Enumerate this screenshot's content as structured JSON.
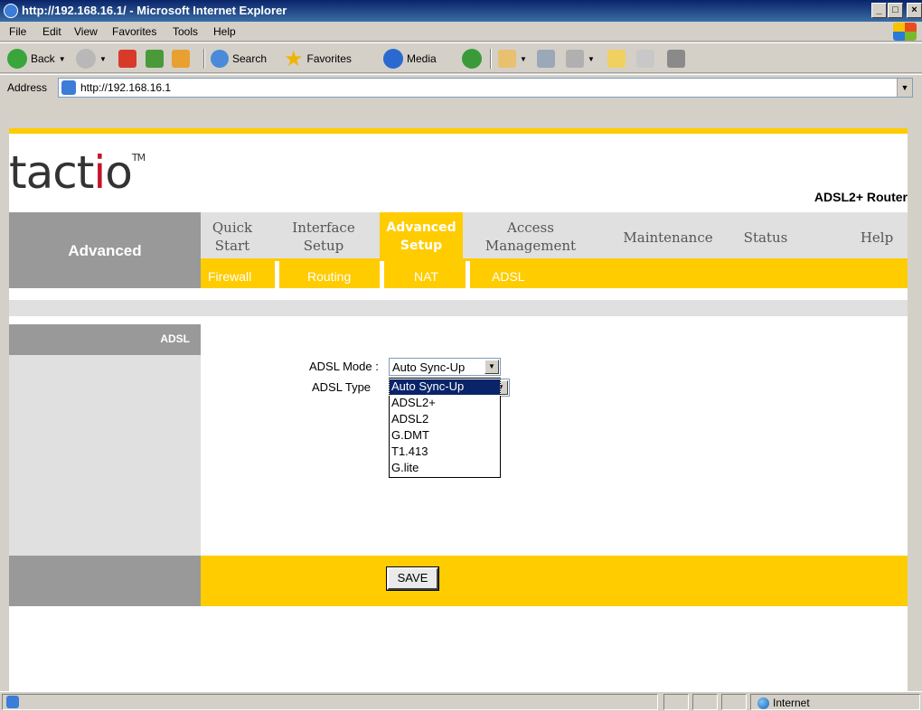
{
  "window": {
    "title": "http://192.168.16.1/ - Microsoft Internet Explorer"
  },
  "menubar": {
    "items": [
      "File",
      "Edit",
      "View",
      "Favorites",
      "Tools",
      "Help"
    ]
  },
  "toolbar": {
    "back": "Back",
    "search": "Search",
    "favorites": "Favorites",
    "media": "Media"
  },
  "address": {
    "label": "Address",
    "url": "http://192.168.16.1"
  },
  "page": {
    "brand": {
      "pre": "tact",
      "accent": "i",
      "post": "o",
      "tm": "TM"
    },
    "product": "ADSL2+ Router",
    "section": "Advanced",
    "nav": [
      {
        "line1": "Quick",
        "line2": "Start"
      },
      {
        "line1": "Interface",
        "line2": "Setup"
      },
      {
        "line1": "Advanced",
        "line2": "Setup"
      },
      {
        "line1": "Access",
        "line2": "Management"
      },
      {
        "line1": "Maintenance",
        "line2": ""
      },
      {
        "line1": "Status",
        "line2": ""
      },
      {
        "line1": "Help",
        "line2": ""
      }
    ],
    "subnav": [
      "Firewall",
      "Routing",
      "NAT",
      "ADSL"
    ],
    "sidebar_label": "ADSL",
    "form": {
      "mode_label": "ADSL Mode :",
      "mode_value": "Auto Sync-Up",
      "type_label": "ADSL Type",
      "options": [
        "Auto Sync-Up",
        "ADSL2+",
        "ADSL2",
        "G.DMT",
        "T1.413",
        "G.lite"
      ],
      "selected_option": "Auto Sync-Up"
    },
    "save_label": "SAVE"
  },
  "statusbar": {
    "zone": "Internet"
  },
  "colors": {
    "yellow": "#ffcc00",
    "gray": "#999999",
    "brand_accent": "#c4142a",
    "selection": "#0a246a"
  }
}
